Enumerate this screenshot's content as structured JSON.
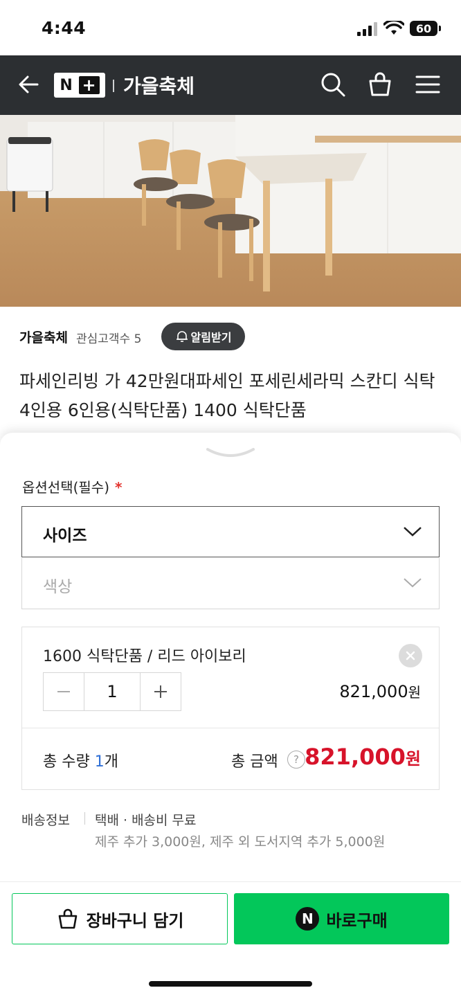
{
  "status": {
    "time": "4:44",
    "battery": "60"
  },
  "header": {
    "logo_left": "N",
    "logo_right": "+",
    "title": "가을축체"
  },
  "store": {
    "name": "가을축체",
    "interest": "관심고객수 5",
    "alarm_label": "알림받기"
  },
  "product": {
    "title": "파세인리빙 가 42만원대파세인 포세린세라믹 스칸디 식탁 4인용 6인용(식탁단품) 1400 식탁단품"
  },
  "options": {
    "label": "옵션선택(필수)",
    "required_mark": "*",
    "select1": "사이즈",
    "select2": "색상"
  },
  "selected_item": {
    "name": "1600 식탁단품 / 리드 아이보리",
    "quantity": "1",
    "price": "821,000",
    "price_unit": "원"
  },
  "totals": {
    "qty_label": "총 수량 ",
    "qty_value": "1",
    "qty_unit": "개",
    "amount_label": "총 금액",
    "help": "?",
    "amount": "821,000",
    "amount_unit": "원"
  },
  "shipping": {
    "label": "배송정보",
    "method": "택배 · 배송비 무료",
    "extra": "제주 추가 3,000원, 제주 외 도서지역 추가 5,000원"
  },
  "actions": {
    "cart": "장바구니 담기",
    "buy_logo": "N",
    "buy": "바로구매"
  },
  "colors": {
    "accent_green": "#03c75a",
    "price_red": "#d7132a",
    "header_bg": "#2c2f32"
  }
}
